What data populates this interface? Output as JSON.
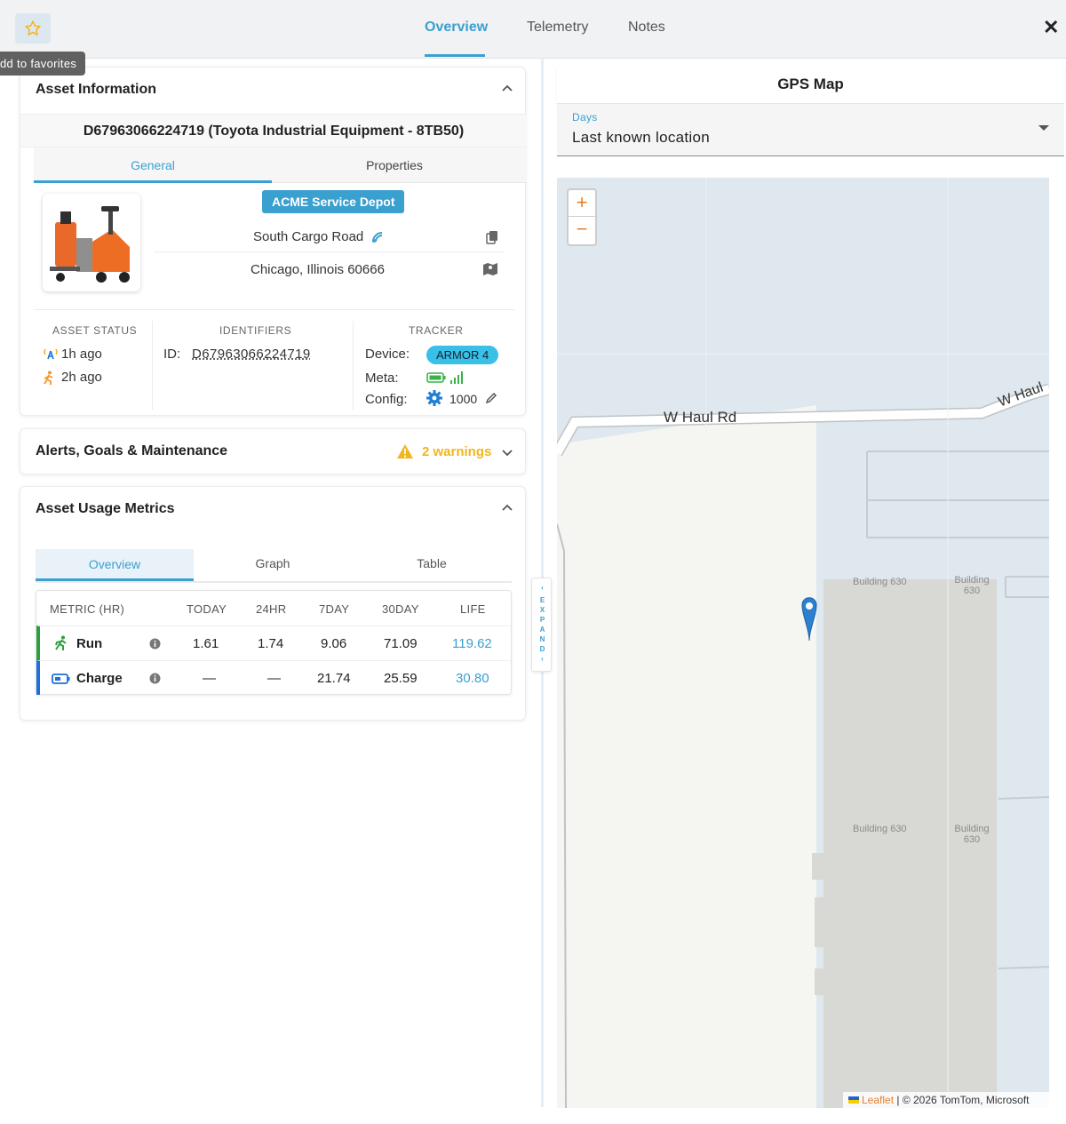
{
  "header": {
    "tabs": [
      {
        "label": "Overview",
        "active": true
      },
      {
        "label": "Telemetry",
        "active": false
      },
      {
        "label": "Notes",
        "active": false
      }
    ],
    "favorite_tooltip": "dd to favorites",
    "close_icon": "close-icon",
    "star_icon": "star-icon"
  },
  "asset_info": {
    "title": "Asset Information",
    "asset_heading": "D67963066224719 (Toyota Industrial Equipment - 8TB50)",
    "subtabs": [
      "General",
      "Properties"
    ],
    "depot": "ACME Service Depot",
    "street": "South Cargo Road",
    "city": "Chicago, Illinois 60666",
    "status": {
      "header": "ASSET STATUS",
      "last_report": "1h ago",
      "last_move": "2h ago"
    },
    "identifiers": {
      "header": "IDENTIFIERS",
      "id_label": "ID:",
      "id_value": "D67963066224719"
    },
    "tracker": {
      "header": "TRACKER",
      "device_label": "Device:",
      "device_value": "ARMOR 4",
      "meta_label": "Meta:",
      "config_label": "Config:",
      "config_value": "1000"
    }
  },
  "alerts": {
    "title": "Alerts, Goals & Maintenance",
    "warnings": "2 warnings"
  },
  "usage": {
    "title": "Asset Usage Metrics",
    "tabs": [
      "Overview",
      "Graph",
      "Table"
    ],
    "columns": [
      "METRIC (HR)",
      "TODAY",
      "24HR",
      "7DAY",
      "30DAY",
      "LIFE"
    ],
    "rows": [
      {
        "name": "Run",
        "today": "1.61",
        "h24": "1.74",
        "d7": "9.06",
        "d30": "71.09",
        "life": "119.62",
        "color": "#2e9f3e"
      },
      {
        "name": "Charge",
        "today": "—",
        "h24": "—",
        "d7": "21.74",
        "d30": "25.59",
        "life": "30.80",
        "color": "#1e6fd9"
      }
    ]
  },
  "expand_label": "EXPAND",
  "gps": {
    "title": "GPS Map",
    "days_label": "Days",
    "days_value": "Last known location",
    "road_1": "W Haul Rd",
    "road_2": "W Haul",
    "building_labels": [
      "Building 630",
      "Building 630",
      "Building 630",
      "Building 630"
    ],
    "zoom_in": "+",
    "zoom_out": "−",
    "attribution_link": "Leaflet",
    "attribution_text": "| © 2026 TomTom, Microsoft"
  },
  "colors": {
    "accent": "#3aa0d0",
    "warning": "#f2b51e",
    "depot": "#3aa0d0",
    "pill": "#39c0e8"
  }
}
